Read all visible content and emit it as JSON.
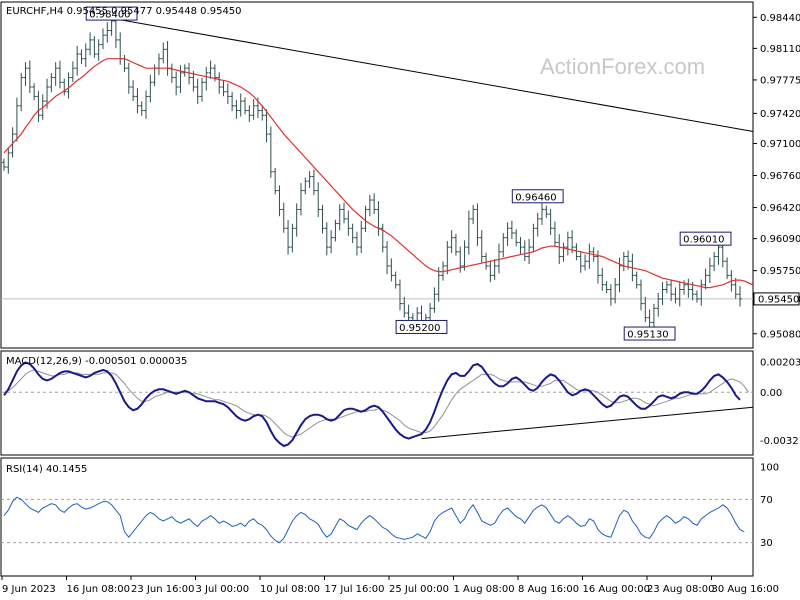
{
  "watermark": "ActionForex.com",
  "chart_data": [
    {
      "type": "ohlc",
      "header": "EURCHF,H4  0.95455 0.95477 0.95448 0.95450",
      "x_ticks": [
        "9 Jun 2023",
        "16 Jun 08:00",
        "23 Jun 16:00",
        "3 Jul 00:00",
        "10 Jul 08:00",
        "17 Jul 16:00",
        "25 Jul 00:00",
        "1 Aug 08:00",
        "8 Aug 16:00",
        "16 Aug 00:00",
        "23 Aug 08:00",
        "30 Aug 16:00"
      ],
      "y_ticks": [
        "0.98440",
        "0.98110",
        "0.97775",
        "0.97420",
        "0.97100",
        "0.96760",
        "0.96420",
        "0.96090",
        "0.95750",
        "0.95450",
        "0.95080"
      ],
      "ylim": [
        0.9495,
        0.9856
      ],
      "current_price": "0.95450",
      "annotations": [
        {
          "label": "0.98400",
          "x_index": 25,
          "value": 0.984
        },
        {
          "label": "0.95200",
          "x_index": 97,
          "value": 0.952
        },
        {
          "label": "0.96460",
          "x_index": 124,
          "value": 0.9646
        },
        {
          "label": "0.95130",
          "x_index": 150,
          "value": 0.9513
        },
        {
          "label": "0.96010",
          "x_index": 163,
          "value": 0.9601
        }
      ],
      "trendline": {
        "from": [
          25,
          0.9843
        ],
        "to": [
          175,
          0.9722
        ]
      },
      "close_series": [
        0.9685,
        0.97,
        0.972,
        0.975,
        0.978,
        0.979,
        0.977,
        0.976,
        0.974,
        0.9755,
        0.977,
        0.978,
        0.979,
        0.9775,
        0.9765,
        0.978,
        0.979,
        0.9805,
        0.98,
        0.981,
        0.982,
        0.9805,
        0.9815,
        0.9825,
        0.983,
        0.984,
        0.982,
        0.98,
        0.979,
        0.977,
        0.976,
        0.975,
        0.9745,
        0.976,
        0.9775,
        0.979,
        0.98,
        0.981,
        0.979,
        0.978,
        0.977,
        0.9785,
        0.979,
        0.978,
        0.977,
        0.976,
        0.9775,
        0.9785,
        0.979,
        0.978,
        0.977,
        0.9765,
        0.976,
        0.975,
        0.9745,
        0.9755,
        0.9745,
        0.974,
        0.975,
        0.9745,
        0.974,
        0.972,
        0.968,
        0.966,
        0.964,
        0.962,
        0.96,
        0.962,
        0.964,
        0.966,
        0.967,
        0.9675,
        0.966,
        0.964,
        0.962,
        0.96,
        0.961,
        0.9625,
        0.964,
        0.963,
        0.962,
        0.961,
        0.96,
        0.962,
        0.964,
        0.965,
        0.964,
        0.962,
        0.96,
        0.958,
        0.957,
        0.956,
        0.954,
        0.953,
        0.9525,
        0.9522,
        0.953,
        0.952,
        0.9525,
        0.9535,
        0.955,
        0.957,
        0.958,
        0.96,
        0.961,
        0.9595,
        0.958,
        0.96,
        0.963,
        0.964,
        0.961,
        0.959,
        0.958,
        0.957,
        0.958,
        0.9595,
        0.961,
        0.962,
        0.9615,
        0.9605,
        0.96,
        0.959,
        0.96,
        0.962,
        0.963,
        0.964,
        0.9635,
        0.962,
        0.9605,
        0.959,
        0.96,
        0.961,
        0.96,
        0.959,
        0.958,
        0.9585,
        0.9595,
        0.959,
        0.957,
        0.956,
        0.9555,
        0.9545,
        0.956,
        0.958,
        0.959,
        0.9585,
        0.957,
        0.956,
        0.954,
        0.9525,
        0.952,
        0.9535,
        0.9545,
        0.9555,
        0.956,
        0.955,
        0.9545,
        0.9555,
        0.956,
        0.9555,
        0.955,
        0.9545,
        0.956,
        0.957,
        0.958,
        0.959,
        0.96,
        0.9585,
        0.957,
        0.956,
        0.955,
        0.9545
      ],
      "ma_series": [
        0.97,
        0.9705,
        0.971,
        0.9715,
        0.972,
        0.9727,
        0.9733,
        0.974,
        0.9745,
        0.9748,
        0.9752,
        0.9756,
        0.976,
        0.9763,
        0.9766,
        0.9769,
        0.9773,
        0.9777,
        0.978,
        0.9784,
        0.9788,
        0.9792,
        0.9795,
        0.9798,
        0.98,
        0.98,
        0.98,
        0.98,
        0.98,
        0.9798,
        0.9796,
        0.9794,
        0.9792,
        0.979,
        0.979,
        0.979,
        0.979,
        0.979,
        0.979,
        0.9789,
        0.9788,
        0.9787,
        0.9786,
        0.9785,
        0.9784,
        0.9783,
        0.9782,
        0.9781,
        0.978,
        0.9779,
        0.9778,
        0.9777,
        0.9776,
        0.9774,
        0.9772,
        0.977,
        0.9767,
        0.9764,
        0.976,
        0.9755,
        0.975,
        0.9744,
        0.9738,
        0.9732,
        0.9726,
        0.972,
        0.9715,
        0.971,
        0.9705,
        0.97,
        0.9695,
        0.969,
        0.9685,
        0.968,
        0.9675,
        0.967,
        0.9665,
        0.966,
        0.9655,
        0.965,
        0.9645,
        0.964,
        0.9636,
        0.9632,
        0.9628,
        0.9625,
        0.9622,
        0.962,
        0.9618,
        0.9615,
        0.9612,
        0.9608,
        0.9604,
        0.96,
        0.9596,
        0.9592,
        0.9588,
        0.9584,
        0.958,
        0.9577,
        0.9575,
        0.9574,
        0.9574,
        0.9575,
        0.9576,
        0.9577,
        0.9578,
        0.9579,
        0.958,
        0.9581,
        0.9582,
        0.9583,
        0.9584,
        0.9585,
        0.9586,
        0.9587,
        0.9588,
        0.9589,
        0.959,
        0.9591,
        0.9592,
        0.9593,
        0.9594,
        0.9595,
        0.9597,
        0.9599,
        0.96,
        0.9601,
        0.9601,
        0.96,
        0.9599,
        0.9598,
        0.9597,
        0.9596,
        0.9595,
        0.9594,
        0.9593,
        0.9592,
        0.9591,
        0.959,
        0.9588,
        0.9586,
        0.9584,
        0.9582,
        0.958,
        0.9579,
        0.9578,
        0.9577,
        0.9576,
        0.9575,
        0.9573,
        0.9571,
        0.9569,
        0.9567,
        0.9566,
        0.9565,
        0.9564,
        0.9563,
        0.9562,
        0.9561,
        0.956,
        0.9559,
        0.9558,
        0.9557,
        0.9557,
        0.9558,
        0.9559,
        0.956,
        0.9562,
        0.9564,
        0.9565,
        0.9565,
        0.9564,
        0.9562,
        0.956
      ]
    },
    {
      "type": "line",
      "header": "MACD(12,26,9) -0.000501 0.000035",
      "y_ticks": [
        "0.002031",
        "0.00",
        "-0.003214"
      ],
      "ylim": [
        -0.004,
        0.0025
      ],
      "macd_series": [
        -0.0002,
        0.0002,
        0.0008,
        0.0014,
        0.0018,
        0.002,
        0.0019,
        0.0016,
        0.0012,
        0.0009,
        0.0008,
        0.0009,
        0.0011,
        0.0013,
        0.0014,
        0.0014,
        0.0013,
        0.0012,
        0.0011,
        0.001,
        0.0011,
        0.0013,
        0.0014,
        0.0015,
        0.0014,
        0.0011,
        0.0006,
        0.0,
        -0.0006,
        -0.001,
        -0.0012,
        -0.0011,
        -0.0008,
        -0.0004,
        -0.0001,
        0.0001,
        0.0002,
        0.0002,
        0.0001,
        0.0,
        -0.0001,
        0.0,
        0.0001,
        0.0,
        -0.0002,
        -0.0004,
        -0.0005,
        -0.0006,
        -0.0006,
        -0.0006,
        -0.0007,
        -0.0008,
        -0.001,
        -0.0013,
        -0.0016,
        -0.0018,
        -0.0019,
        -0.0018,
        -0.0016,
        -0.0015,
        -0.0016,
        -0.002,
        -0.0026,
        -0.0031,
        -0.0034,
        -0.0036,
        -0.0035,
        -0.0032,
        -0.0027,
        -0.0022,
        -0.0018,
        -0.0016,
        -0.0015,
        -0.0015,
        -0.0016,
        -0.0018,
        -0.0019,
        -0.0018,
        -0.0015,
        -0.0012,
        -0.0011,
        -0.0011,
        -0.0012,
        -0.0013,
        -0.0012,
        -0.001,
        -0.0009,
        -0.001,
        -0.0013,
        -0.0017,
        -0.0021,
        -0.0025,
        -0.0028,
        -0.003,
        -0.0031,
        -0.003,
        -0.0029,
        -0.0028,
        -0.0025,
        -0.002,
        -0.0013,
        -0.0005,
        0.0002,
        0.0008,
        0.0012,
        0.0013,
        0.0011,
        0.0011,
        0.0014,
        0.0018,
        0.0019,
        0.0017,
        0.0013,
        0.0009,
        0.0006,
        0.0004,
        0.0004,
        0.0006,
        0.0009,
        0.001,
        0.0008,
        0.0005,
        0.0002,
        0.0001,
        0.0003,
        0.0007,
        0.001,
        0.0012,
        0.0011,
        0.0008,
        0.0004,
        0.0,
        -0.0002,
        -0.0001,
        0.0001,
        0.0002,
        0.0001,
        -0.0002,
        -0.0005,
        -0.0008,
        -0.001,
        -0.0009,
        -0.0006,
        -0.0003,
        -0.0002,
        -0.0003,
        -0.0006,
        -0.0009,
        -0.0011,
        -0.0011,
        -0.0009,
        -0.0006,
        -0.0003,
        -0.0002,
        -0.0003,
        -0.0004,
        -0.0003,
        -0.0001,
        0.0,
        0.0,
        -0.0001,
        -0.0001,
        0.0001,
        0.0004,
        0.0008,
        0.0011,
        0.0012,
        0.001,
        0.0007,
        0.0003,
        -0.0002,
        -0.0005
      ],
      "signal_series": [
        0.0,
        0.0001,
        0.0003,
        0.0006,
        0.0009,
        0.0012,
        0.0014,
        0.0015,
        0.0014,
        0.0013,
        0.0012,
        0.0011,
        0.0011,
        0.0012,
        0.0012,
        0.0013,
        0.0013,
        0.0013,
        0.0012,
        0.0012,
        0.0012,
        0.0012,
        0.0012,
        0.0013,
        0.0013,
        0.0013,
        0.0012,
        0.0009,
        0.0006,
        0.0002,
        -0.0001,
        -0.0004,
        -0.0006,
        -0.0006,
        -0.0005,
        -0.0003,
        -0.0002,
        -0.0001,
        0.0,
        0.0,
        0.0,
        0.0,
        0.0,
        0.0,
        -0.0001,
        -0.0001,
        -0.0002,
        -0.0003,
        -0.0004,
        -0.0005,
        -0.0005,
        -0.0006,
        -0.0007,
        -0.0008,
        -0.0009,
        -0.0011,
        -0.0013,
        -0.0014,
        -0.0015,
        -0.0015,
        -0.0015,
        -0.0016,
        -0.0018,
        -0.0021,
        -0.0024,
        -0.0027,
        -0.0029,
        -0.003,
        -0.0029,
        -0.0028,
        -0.0026,
        -0.0024,
        -0.0022,
        -0.002,
        -0.0019,
        -0.0018,
        -0.0018,
        -0.0018,
        -0.0017,
        -0.0016,
        -0.0015,
        -0.0014,
        -0.0013,
        -0.0013,
        -0.0013,
        -0.0012,
        -0.0012,
        -0.0011,
        -0.0012,
        -0.0013,
        -0.0015,
        -0.0017,
        -0.0019,
        -0.0022,
        -0.0024,
        -0.0025,
        -0.0026,
        -0.0027,
        -0.0027,
        -0.0026,
        -0.0023,
        -0.0019,
        -0.0015,
        -0.001,
        -0.0005,
        -0.0001,
        0.0002,
        0.0004,
        0.0006,
        0.0008,
        0.001,
        0.0012,
        0.0012,
        0.0012,
        0.0011,
        0.0009,
        0.0008,
        0.0007,
        0.0007,
        0.0007,
        0.0007,
        0.0007,
        0.0006,
        0.0005,
        0.0004,
        0.0004,
        0.0005,
        0.0006,
        0.0008,
        0.0008,
        0.0008,
        0.0006,
        0.0004,
        0.0002,
        0.0001,
        0.0001,
        0.0001,
        0.0001,
        0.0,
        -0.0002,
        -0.0004,
        -0.0006,
        -0.0007,
        -0.0007,
        -0.0006,
        -0.0005,
        -0.0004,
        -0.0004,
        -0.0005,
        -0.0007,
        -0.0008,
        -0.0009,
        -0.0008,
        -0.0007,
        -0.0006,
        -0.0005,
        -0.0004,
        -0.0004,
        -0.0003,
        -0.0002,
        -0.0001,
        -0.0001,
        -0.0001,
        -0.0001,
        0.0,
        0.0002,
        0.0004,
        0.0006,
        0.0008,
        0.0009,
        0.0008,
        0.0007,
        0.0004,
        0.0
      ],
      "trendline": {
        "from": [
          97,
          -0.0031
        ],
        "to": [
          175,
          -0.001
        ]
      }
    },
    {
      "type": "line",
      "header": "RSI(14) 40.1455",
      "y_ticks": [
        "100",
        "70",
        "30",
        "0"
      ],
      "ylim": [
        0,
        100
      ],
      "levels": [
        70,
        30
      ],
      "rsi_series": [
        55,
        60,
        68,
        72,
        70,
        66,
        62,
        60,
        58,
        62,
        64,
        66,
        65,
        60,
        58,
        62,
        65,
        66,
        63,
        61,
        62,
        64,
        66,
        68,
        68,
        65,
        60,
        55,
        40,
        35,
        40,
        45,
        50,
        55,
        58,
        56,
        52,
        50,
        52,
        54,
        50,
        48,
        50,
        52,
        48,
        45,
        50,
        52,
        55,
        52,
        48,
        50,
        48,
        45,
        46,
        48,
        45,
        50,
        52,
        48,
        46,
        42,
        36,
        32,
        30,
        34,
        42,
        50,
        55,
        58,
        56,
        52,
        50,
        47,
        40,
        35,
        38,
        45,
        52,
        50,
        46,
        44,
        42,
        48,
        52,
        55,
        52,
        48,
        44,
        42,
        38,
        35,
        34,
        33,
        34,
        35,
        38,
        36,
        34,
        40,
        50,
        55,
        58,
        60,
        62,
        55,
        48,
        52,
        60,
        65,
        58,
        50,
        48,
        46,
        48,
        55,
        60,
        62,
        58,
        54,
        52,
        48,
        54,
        60,
        63,
        65,
        62,
        56,
        50,
        48,
        52,
        55,
        52,
        48,
        45,
        46,
        52,
        50,
        42,
        38,
        36,
        35,
        45,
        55,
        60,
        58,
        50,
        45,
        38,
        35,
        34,
        40,
        48,
        52,
        55,
        52,
        48,
        50,
        54,
        52,
        48,
        46,
        52,
        55,
        58,
        60,
        62,
        65,
        62,
        56,
        48,
        42,
        40
      ]
    }
  ]
}
